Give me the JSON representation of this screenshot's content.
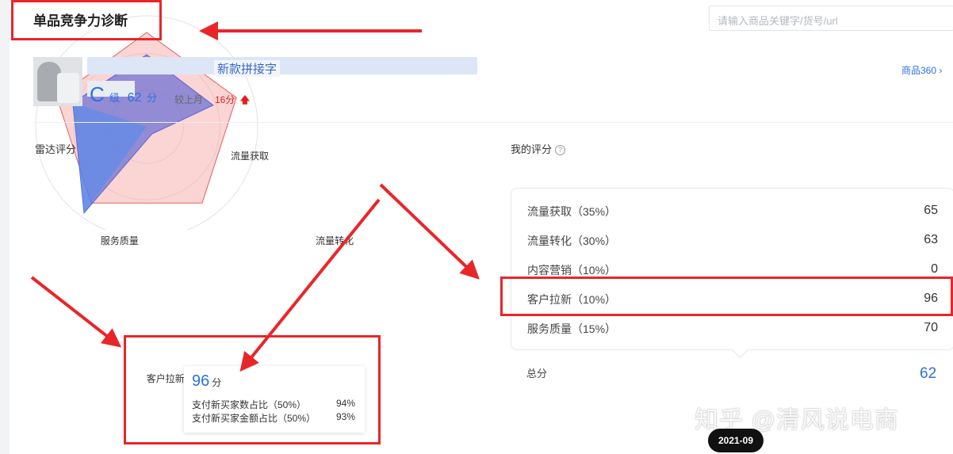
{
  "header": {
    "title": "单品竞争力诊断",
    "search_placeholder": "请输入商品关键字/货号/url"
  },
  "product": {
    "title_fragment": "新款拼接字",
    "grade_letter": "C",
    "grade_unit": "级",
    "score": "62",
    "score_unit": "分",
    "compare_label": "较上月",
    "compare_value": "16分",
    "link_label": "商品360 ›"
  },
  "radar": {
    "title": "雷达评分",
    "axes": [
      "流量获取",
      "流量转化",
      "内容营销",
      "客户拉新",
      "服务质量"
    ],
    "series": [
      {
        "values": [
          65,
          63,
          0,
          96,
          70
        ],
        "color": "#6f79d6"
      },
      {
        "values": [
          85,
          85,
          85,
          85,
          85
        ],
        "color": "#f7b9b9"
      }
    ]
  },
  "tooltip": {
    "score": "96",
    "unit": "分",
    "rows": [
      {
        "label": "支付新买家数占比（50%）",
        "value": "94%"
      },
      {
        "label": "支付新买家金额占比（50%）",
        "value": "93%"
      }
    ]
  },
  "my_score": {
    "title": "我的评分",
    "info_icon": "question-circle-icon",
    "rows": [
      {
        "label": "流量获取（35%）",
        "value": "65"
      },
      {
        "label": "流量转化（30%）",
        "value": "63"
      },
      {
        "label": "内容营销（10%）",
        "value": "0"
      },
      {
        "label": "客户拉新（10%）",
        "value": "96"
      },
      {
        "label": "服务质量（15%）",
        "value": "70"
      }
    ],
    "total_label": "总分",
    "total_value": "62"
  },
  "overlay": {
    "watermark": "知乎 @清风说电商",
    "date": "2021-09"
  },
  "colors": {
    "accent": "#2e6fe6",
    "alert": "#e8262a",
    "up": "#e02020"
  }
}
